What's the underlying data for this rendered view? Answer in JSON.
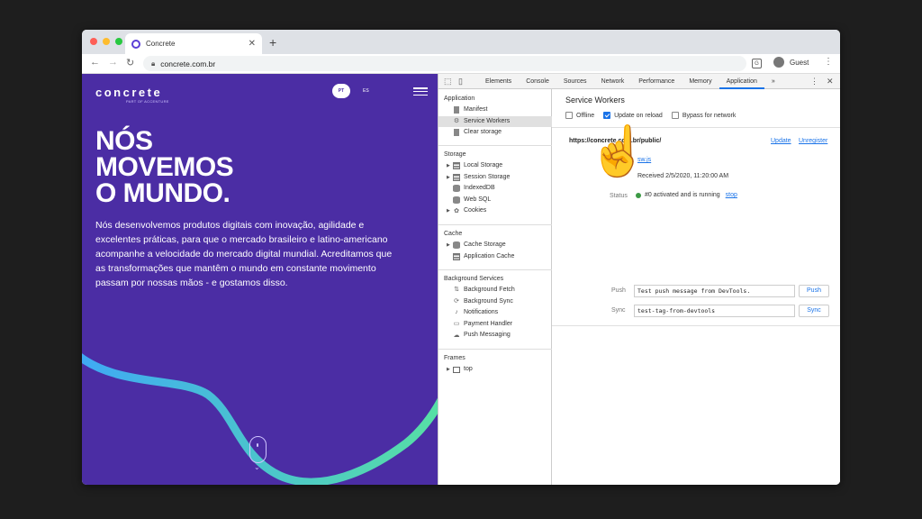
{
  "browser": {
    "tab_title": "Concrete",
    "url": "concrete.com.br",
    "profile_label": "Guest",
    "icons": {
      "back": "back-arrow-icon",
      "forward": "forward-arrow-icon",
      "reload": "reload-icon",
      "lock": "lock-icon",
      "translate": "translate-icon",
      "menu": "kebab-menu-icon"
    }
  },
  "site": {
    "logo": "concrete",
    "logo_sub": "PART OF ACCENTURE",
    "lang_pt": "PT",
    "lang_es": "ES",
    "headline": [
      "NÓS",
      "MOVEMOS",
      "O MUNDO."
    ],
    "body": "Nós desenvolvemos produtos digitais com inovação, agilidade e excelentes práticas, para que o mercado brasileiro e latino-americano acompanhe a velocidade do mercado digital mundial. Acreditamos que as transformações que mantêm o mundo em constante movimento passam por nossas mãos - e gostamos disso.",
    "colors": {
      "background": "#4b2da4",
      "wave_start": "#3fa9f5",
      "wave_end": "#57e0a4"
    }
  },
  "devtools": {
    "tabs": [
      "Elements",
      "Console",
      "Sources",
      "Network",
      "Performance",
      "Memory",
      "Application"
    ],
    "active_tab": "Application",
    "more": "»",
    "sidebar": {
      "application": {
        "title": "Application",
        "items": [
          "Manifest",
          "Service Workers",
          "Clear storage"
        ]
      },
      "storage": {
        "title": "Storage",
        "items": [
          "Local Storage",
          "Session Storage",
          "IndexedDB",
          "Web SQL",
          "Cookies"
        ]
      },
      "cache": {
        "title": "Cache",
        "items": [
          "Cache Storage",
          "Application Cache"
        ]
      },
      "background": {
        "title": "Background Services",
        "items": [
          "Background Fetch",
          "Background Sync",
          "Notifications",
          "Payment Handler",
          "Push Messaging"
        ]
      },
      "frames": {
        "title": "Frames",
        "items": [
          "top"
        ]
      }
    },
    "service_workers": {
      "title": "Service Workers",
      "offline_label": "Offline",
      "offline_checked": false,
      "update_on_reload_label": "Update on reload",
      "update_on_reload_checked": true,
      "bypass_label": "Bypass for network",
      "bypass_checked": false,
      "scope": "https://concrete.com.br/public/",
      "update_link": "Update",
      "unregister_link": "Unregister",
      "source": "sw.js",
      "received": "Received 2/5/2020, 11:20:00 AM",
      "status_label": "Status",
      "status_text": "#0 activated and is running",
      "stop_link": "stop",
      "push_label": "Push",
      "push_value": "Test push message from DevTools.",
      "push_button": "Push",
      "sync_label": "Sync",
      "sync_value": "test-tag-from-devtools",
      "sync_button": "Sync"
    }
  },
  "overlay": {
    "emoji": "☝️"
  }
}
